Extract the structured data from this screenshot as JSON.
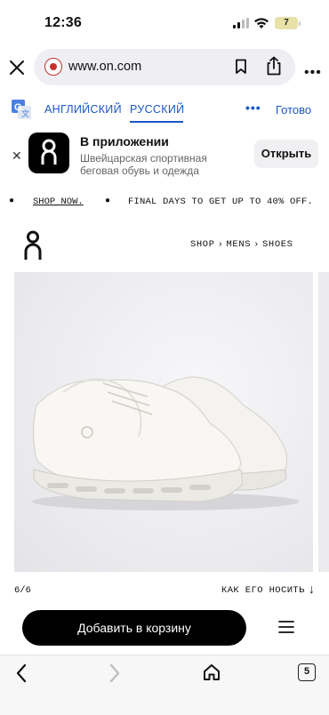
{
  "status_bar": {
    "time": "12:36",
    "battery": "7"
  },
  "browser": {
    "url": "www.on.com",
    "bottom_nav": {
      "tab_count": "5"
    }
  },
  "translate": {
    "source_lang": "АНГЛИЙСКИЙ",
    "target_lang": "РУССКИЙ",
    "more": "•••",
    "done": "Готово"
  },
  "app_banner": {
    "title": "В приложении",
    "subtitle_line1": "Швейцарская спортивная",
    "subtitle_line2": "беговая обувь и одежда",
    "open_label": "Открыть"
  },
  "promo": {
    "shop_now": "SHOP NOW.",
    "message": "FINAL DAYS TO GET UP TO 40% OFF."
  },
  "breadcrumb": [
    "SHOP",
    "MENS",
    "SHOES"
  ],
  "gallery": {
    "counter": "6/6"
  },
  "how_to_wear": "КАК ЕГО НОСИТЬ",
  "cart": {
    "add_label": "Добавить в корзину"
  },
  "colors": {
    "accent": "#1a56c8",
    "warning": "#c9302c",
    "black": "#000000"
  }
}
